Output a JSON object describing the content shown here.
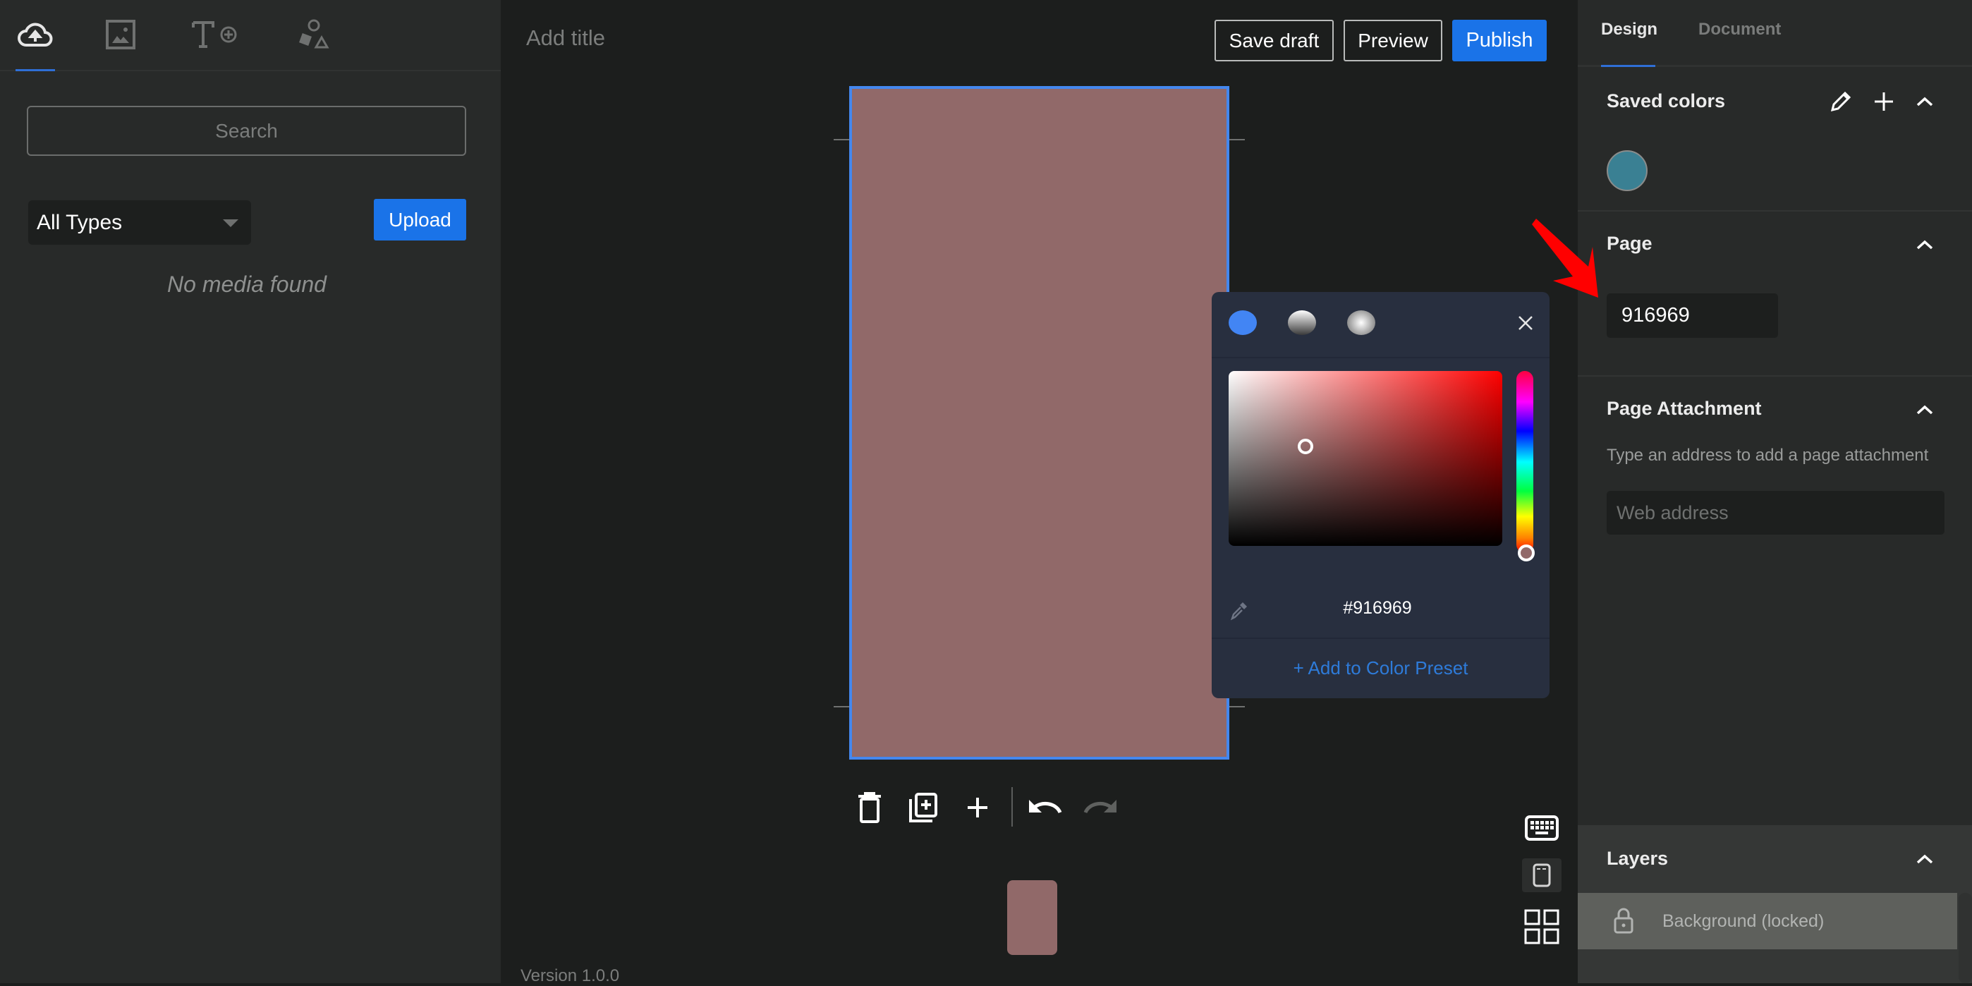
{
  "left_panel": {
    "tabs": [
      {
        "icon": "cloud-upload-icon",
        "label": "Uploads",
        "active": true
      },
      {
        "icon": "image-icon",
        "label": "Media",
        "active": false
      },
      {
        "icon": "add-text-icon",
        "label": "Text",
        "active": false
      },
      {
        "icon": "shapes-icon",
        "label": "Shapes",
        "active": false
      }
    ],
    "search_placeholder": "Search",
    "type_filter": "All Types",
    "upload_label": "Upload",
    "empty_message": "No media found"
  },
  "header": {
    "title_placeholder": "Add title",
    "save_draft_label": "Save draft",
    "preview_label": "Preview",
    "publish_label": "Publish"
  },
  "canvas": {
    "page_color": "#916969",
    "selection_color": "#4487ee"
  },
  "color_picker": {
    "modes": [
      "solid",
      "linear-gradient",
      "radial-gradient"
    ],
    "active_mode": "solid",
    "hex_value": "#916969",
    "hue_degrees": 0,
    "saturation": 0.28,
    "value": 0.57,
    "add_preset_label": "+ Add to Color Preset"
  },
  "toolbar": {
    "delete": "trash-icon",
    "duplicate": "duplicate-page-icon",
    "add": "add-page-icon",
    "undo": "undo-icon",
    "redo": "redo-icon",
    "redo_disabled": true
  },
  "side_controls": [
    "keyboard-icon",
    "mobile-view-icon",
    "grid-view-icon"
  ],
  "version": "Version 1.0.0",
  "right_panel": {
    "tabs": [
      {
        "label": "Design",
        "active": true
      },
      {
        "label": "Document",
        "active": false
      }
    ],
    "saved_colors": {
      "title": "Saved colors",
      "colors": [
        "#3a8093"
      ]
    },
    "page": {
      "title": "Page",
      "color_hex": "916969",
      "color": "#916969"
    },
    "page_attachment": {
      "title": "Page Attachment",
      "description": "Type an address to add a page attachment",
      "placeholder": "Web address"
    },
    "layers": {
      "title": "Layers",
      "items": [
        {
          "label": "Background (locked)",
          "locked": true
        }
      ]
    }
  },
  "annotation": {
    "arrow_color": "#ff0000",
    "points_to": "page-color-input"
  }
}
